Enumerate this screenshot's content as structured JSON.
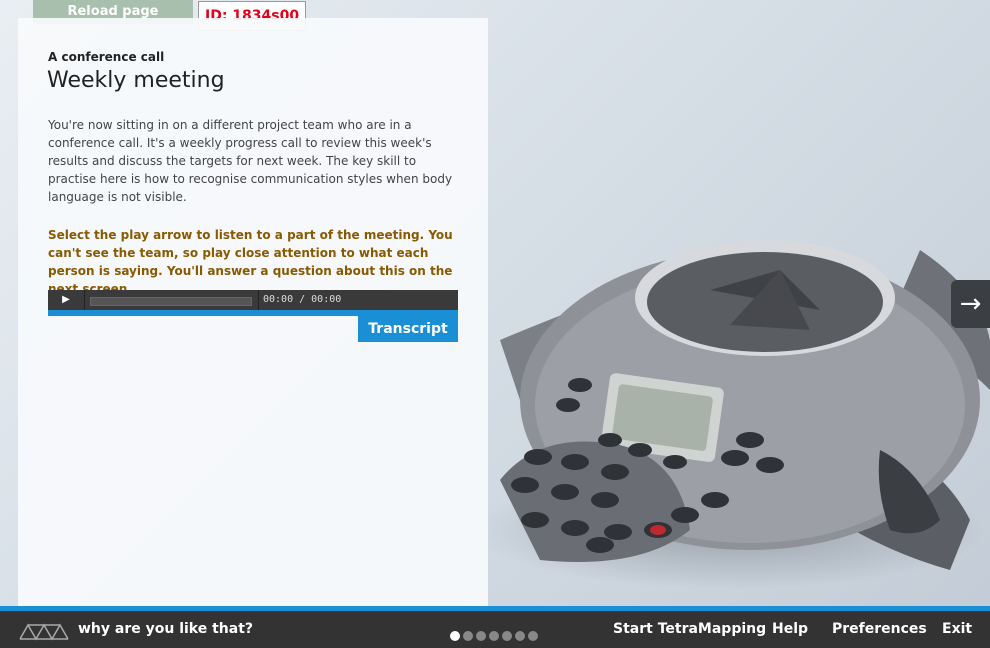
{
  "top_bar": {
    "reload_label": "Reload page",
    "id_label": "ID: 1834s00"
  },
  "content": {
    "subtitle": "A conference call",
    "title": "Weekly meeting",
    "body": "You're now sitting in on a different project team who are in a conference call. It's a weekly progress call to review this week's results and discuss the targets for next week. The key skill to practise here is how to recognise communication styles when body language is not visible.",
    "instruction": "Select the play arrow to listen to a part of the meeting. You can't see the team, so play close attention to what each person is saying. You'll answer a question about this on the next screen."
  },
  "player": {
    "play_icon": "play-icon",
    "time_label": "00:00 / 00:00"
  },
  "transcript_label": "Transcript",
  "next_icon": "arrow-right-icon",
  "footer": {
    "tagline": "why are you like that?",
    "progress": {
      "total": 7,
      "current": 1
    },
    "nav": {
      "start_label": "Start TetraMapping",
      "help_label": "Help",
      "preferences_label": "Preferences",
      "exit_label": "Exit"
    }
  },
  "colors": {
    "accent": "#1a8fd6",
    "instruction": "#8a5a00",
    "id_text": "#e2001a"
  }
}
